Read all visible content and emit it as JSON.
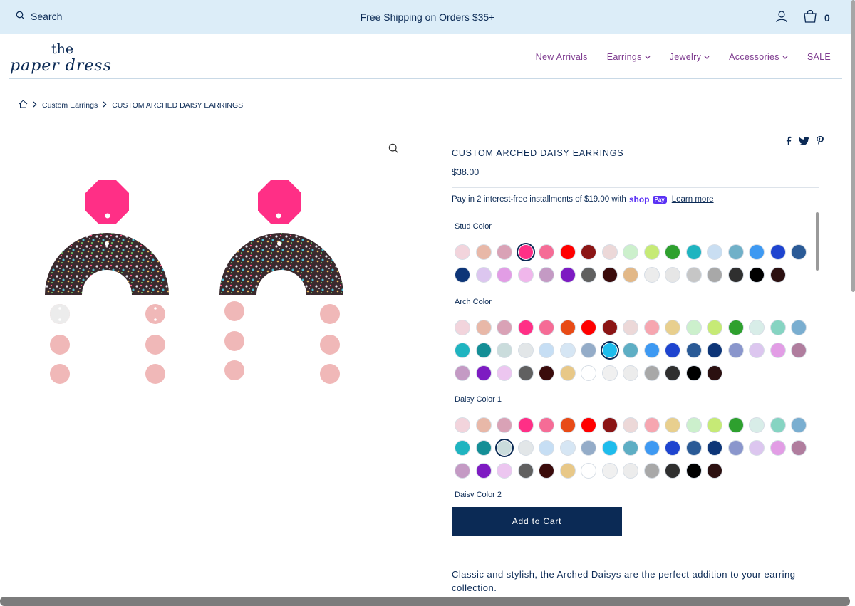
{
  "topbar": {
    "search_label": "Search",
    "promo": "Free Shipping on Orders $35+",
    "cart_count": "0"
  },
  "logo": {
    "line1": "the",
    "line2": "paper dress"
  },
  "nav": {
    "items": [
      {
        "label": "New Arrivals",
        "dropdown": false
      },
      {
        "label": "Earrings",
        "dropdown": true
      },
      {
        "label": "Jewelry",
        "dropdown": true
      },
      {
        "label": "Accessories",
        "dropdown": true
      },
      {
        "label": "SALE",
        "dropdown": false
      }
    ]
  },
  "breadcrumb": {
    "category": "Custom Earrings",
    "current": "CUSTOM ARCHED DAISY EARRINGS"
  },
  "product": {
    "title": "CUSTOM ARCHED DAISY EARRINGS",
    "price": "$38.00",
    "shoppay_text": "Pay in 2 interest-free installments of $19.00 with",
    "shoppay_brand": "shop",
    "shoppay_pay": "Pay",
    "learn_more": "Learn more",
    "add_to_cart": "Add to Cart",
    "description": "Classic and stylish, the Arched Daisys are the perfect addition to your earring collection.",
    "image": {
      "stud_color": "#ff2f86",
      "arch_style": "multicolor glitter",
      "daisy_color": "#f0b8b8",
      "daisy_alt_color": "#ececec"
    }
  },
  "options": [
    {
      "label": "Stud Color",
      "selected_index": 3,
      "colors": [
        "#f2d4dc",
        "#e8b8a8",
        "#d9a2b6",
        "#ff2f86",
        "#f56c96",
        "#ff0000",
        "#8b1515",
        "#ecd8d8",
        "#ccf0cc",
        "#c6ea76",
        "#2ea02e",
        "#1fb4c0",
        "#c9def2",
        "#70b0c8",
        "#3e99f2",
        "#1e44cf",
        "#2a5a96",
        "#0d3577",
        "#dcc6ef",
        "#e29de5",
        "#f0b6eb",
        "#c49ac4",
        "#7d1bc2",
        "#606060",
        "#3a0b0b",
        "#e2b888",
        "#ececec",
        "#e6e6e6",
        "#c6c6c6",
        "#a8a8a8",
        "#2f2f2f",
        "#000000",
        "#2b1010"
      ]
    },
    {
      "label": "Arch Color",
      "selected_index": 24,
      "colors": [
        "#f2d4dc",
        "#e8b8a8",
        "#d9a2b6",
        "#ff2f86",
        "#f56c96",
        "#e84b16",
        "#ff0000",
        "#8b1515",
        "#ecd8d8",
        "#f6a6b0",
        "#e8cf8e",
        "#ccf0cc",
        "#c6ea76",
        "#2ea02e",
        "#d8ede8",
        "#86d4c2",
        "#7aaed0",
        "#1fb4c0",
        "#148e96",
        "#cadcdc",
        "#e2e6e8",
        "#c6def4",
        "#d6e6f4",
        "#94acc8",
        "#1ebcec",
        "#5eaec4",
        "#3e99f2",
        "#1e44cf",
        "#2a5a96",
        "#0d3577",
        "#8a96cc",
        "#dcc6ef",
        "#e29de5",
        "#b07d9e",
        "#c49ac4",
        "#7d1bc2",
        "#ecc6f0",
        "#606060",
        "#3a0b0b",
        "#e8c888",
        "#ffffff",
        "#f0f0f0",
        "#ececec",
        "#a8a8a8",
        "#2f2f2f",
        "#000000",
        "#2b1010"
      ]
    },
    {
      "label": "Daisy Color 1",
      "selected_index": 19,
      "colors": [
        "#f2d4dc",
        "#e8b8a8",
        "#d9a2b6",
        "#ff2f86",
        "#f56c96",
        "#e84b16",
        "#ff0000",
        "#8b1515",
        "#ecd8d8",
        "#f6a6b0",
        "#e8cf8e",
        "#ccf0cc",
        "#c6ea76",
        "#2ea02e",
        "#d8ede8",
        "#86d4c2",
        "#7aaed0",
        "#1fb4c0",
        "#148e96",
        "#cadcdc",
        "#e2e6e8",
        "#c6def4",
        "#d6e6f4",
        "#94acc8",
        "#1ebcec",
        "#5eaec4",
        "#3e99f2",
        "#1e44cf",
        "#2a5a96",
        "#0d3577",
        "#8a96cc",
        "#dcc6ef",
        "#e29de5",
        "#b07d9e",
        "#c49ac4",
        "#7d1bc2",
        "#ecc6f0",
        "#606060",
        "#3a0b0b",
        "#e8c888",
        "#ffffff",
        "#f0f0f0",
        "#ececec",
        "#a8a8a8",
        "#2f2f2f",
        "#000000",
        "#2b1010"
      ]
    },
    {
      "label": "Daisy Color 2",
      "selected_index": -1,
      "colors": []
    }
  ],
  "colors": {
    "brand": "#0b2a55",
    "nav": "#7e3b8f",
    "topbar_bg": "#dcedf8"
  }
}
